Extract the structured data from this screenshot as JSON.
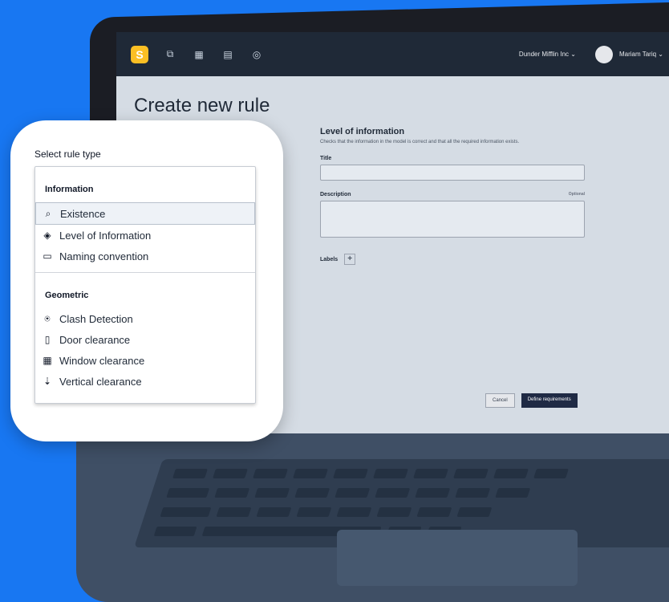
{
  "app": {
    "logo_letter": "S",
    "org_label": "Dunder Mifflin Inc",
    "user_label": "Mariam Tariq",
    "page_title": "Create new rule"
  },
  "form": {
    "title": "Level of information",
    "subtitle": "Checks that the information in the model is correct and that all the required information exists.",
    "title_label": "Title",
    "description_label": "Description",
    "optional_label": "Optional",
    "labels_label": "Labels",
    "cancel_label": "Cancel",
    "define_label": "Define requirements"
  },
  "picker": {
    "heading": "Select rule type",
    "sections": [
      {
        "name": "Information",
        "items": [
          {
            "label": "Existence",
            "icon": "existence-icon",
            "selected": true
          },
          {
            "label": "Level of Information",
            "icon": "layers-icon",
            "selected": false
          },
          {
            "label": "Naming convention",
            "icon": "naming-icon",
            "selected": false
          }
        ]
      },
      {
        "name": "Geometric",
        "items": [
          {
            "label": "Clash Detection",
            "icon": "clash-icon",
            "selected": false
          },
          {
            "label": "Door clearance",
            "icon": "door-icon",
            "selected": false
          },
          {
            "label": "Window clearance",
            "icon": "window-icon",
            "selected": false
          },
          {
            "label": "Vertical clearance",
            "icon": "vertical-clearance-icon",
            "selected": false
          }
        ]
      }
    ]
  },
  "colors": {
    "background": "#1877f2",
    "logo": "#fbbf24",
    "appbar": "#1f2937",
    "primary_button": "#1f2a44"
  }
}
